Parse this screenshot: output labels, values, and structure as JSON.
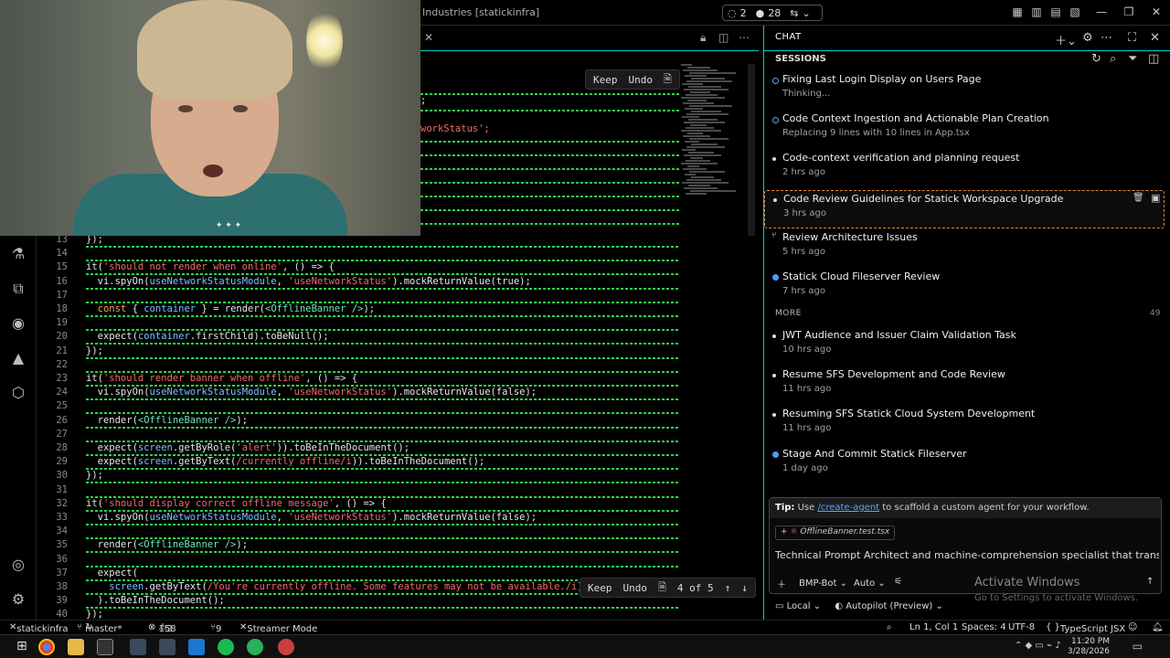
{
  "titlebar": {
    "title": "Industries [statickinfra]",
    "sync_count": "2",
    "changes_count": "28"
  },
  "editor_tabs": {
    "keep_label": "Keep",
    "undo_label": "Undo"
  },
  "editor_top_fragments": [
    ";",
    "workStatus';"
  ],
  "editor_lines": [
    {
      "n": "13",
      "code": "});"
    },
    {
      "n": "14",
      "code": ""
    },
    {
      "n": "15",
      "code": "it('should not render when online', () => {"
    },
    {
      "n": "16",
      "code": "  vi.spyOn(useNetworkStatusModule, 'useNetworkStatus').mockReturnValue(true);"
    },
    {
      "n": "17",
      "code": ""
    },
    {
      "n": "18",
      "code": "  const { container } = render(<OfflineBanner />);"
    },
    {
      "n": "19",
      "code": ""
    },
    {
      "n": "20",
      "code": "  expect(container.firstChild).toBeNull();"
    },
    {
      "n": "21",
      "code": "});"
    },
    {
      "n": "22",
      "code": ""
    },
    {
      "n": "23",
      "code": "it('should render banner when offline', () => {"
    },
    {
      "n": "24",
      "code": "  vi.spyOn(useNetworkStatusModule, 'useNetworkStatus').mockReturnValue(false);"
    },
    {
      "n": "25",
      "code": ""
    },
    {
      "n": "26",
      "code": "  render(<OfflineBanner />);"
    },
    {
      "n": "27",
      "code": ""
    },
    {
      "n": "28",
      "code": "  expect(screen.getByRole('alert')).toBeInTheDocument();"
    },
    {
      "n": "29",
      "code": "  expect(screen.getByText(/currently offline/i)).toBeInTheDocument();"
    },
    {
      "n": "30",
      "code": "});"
    },
    {
      "n": "31",
      "code": ""
    },
    {
      "n": "32",
      "code": "it('should display correct offline message', () => {"
    },
    {
      "n": "33",
      "code": "  vi.spyOn(useNetworkStatusModule, 'useNetworkStatus').mockReturnValue(false);"
    },
    {
      "n": "34",
      "code": ""
    },
    {
      "n": "35",
      "code": "  render(<OfflineBanner />);"
    },
    {
      "n": "36",
      "code": ""
    },
    {
      "n": "37",
      "code": "  expect("
    },
    {
      "n": "38",
      "code": "    screen.getByText(/You're currently offline. Some features may not be available./i)"
    },
    {
      "n": "39",
      "code": "  ).toBeInTheDocument();"
    },
    {
      "n": "40",
      "code": "});"
    }
  ],
  "diff_bar": {
    "keep_label": "Keep",
    "undo_label": "Undo",
    "position": "4 of 5"
  },
  "chat": {
    "header_label": "CHAT",
    "sessions_label": "SESSIONS",
    "sessions": [
      {
        "title": "Fixing Last Login Display on Users Page",
        "sub": "Thinking...",
        "status": "running"
      },
      {
        "title": "Code Context Ingestion and Actionable Plan Creation",
        "sub": "Replacing 9 lines with 10 lines in App.tsx",
        "status": "running"
      },
      {
        "title": "Code-context verification and planning request",
        "sub": "2 hrs ago",
        "status": "done"
      },
      {
        "title": "Code Review Guidelines for Statick Workspace Upgrade",
        "sub": "3 hrs ago",
        "status": "done"
      },
      {
        "title": "Review Architecture Issues",
        "sub": "5 hrs ago",
        "status": "branch"
      },
      {
        "title": "Statick Cloud Fileserver Review",
        "sub": "7 hrs ago",
        "status": "unread"
      }
    ],
    "more_label": "MORE",
    "more_count": "49",
    "more_sessions": [
      {
        "title": "JWT Audience and Issuer Claim Validation Task",
        "sub": "10 hrs ago",
        "status": "done"
      },
      {
        "title": "Resume SFS Development and Code Review",
        "sub": "11 hrs ago",
        "status": "done"
      },
      {
        "title": "Resuming SFS Statick Cloud System Development",
        "sub": "11 hrs ago",
        "status": "done"
      },
      {
        "title": "Stage And Commit Statick Fileserver",
        "sub": "1 day ago",
        "status": "unread"
      }
    ],
    "tip_prefix": "Tip:",
    "tip_text_1": "Use",
    "tip_link": "/create-agent",
    "tip_text_2": "to scaffold a custom agent for your workflow.",
    "file_chip": "OfflineBanner.test.tsx",
    "prompt": "Technical Prompt Architect and machine-comprehension specialist that transforms raw hum",
    "agent_label": "BMP-Bot",
    "mode_label": "Auto",
    "local_label": "Local",
    "autopilot_label": "Autopilot (Preview)",
    "watermark_title": "Activate Windows",
    "watermark_sub": "Go to Settings to activate Windows."
  },
  "statusbar": {
    "branch_remote": "statickinfra",
    "branch": "master*",
    "errors": "158",
    "warnings": "2",
    "ports": "9",
    "streamer": "Streamer Mode",
    "position": "Ln 1, Col 1",
    "spaces": "Spaces: 4",
    "encoding": "UTF-8",
    "language": "TypeScript JSX"
  },
  "taskbar": {
    "time": "11:20 PM",
    "date": "3/28/2026"
  },
  "colors": {
    "accent_cyan": "#00d0d0",
    "diff_green": "#2fd04a",
    "active_session_border": "#e4883a",
    "running_indicator": "#5aa6ff"
  }
}
